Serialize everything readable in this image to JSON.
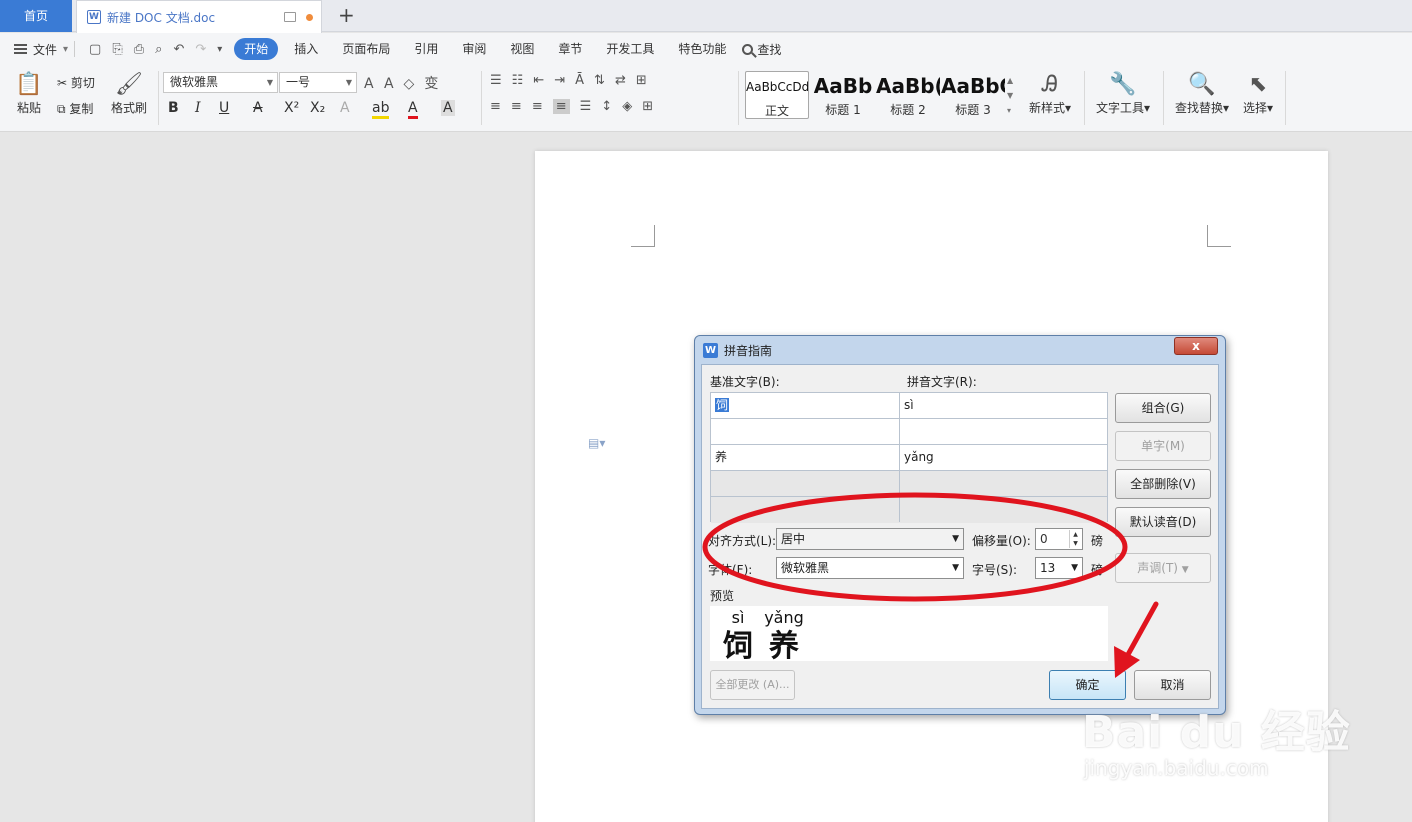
{
  "tabbar": {
    "home_label": "首页",
    "doc_tab_label": "新建 DOC 文档.doc",
    "add_label": "+"
  },
  "menubar": {
    "file_label": "文件",
    "tabs": [
      "开始",
      "插入",
      "页面布局",
      "引用",
      "审阅",
      "视图",
      "章节",
      "开发工具",
      "特色功能"
    ],
    "search_label": "查找",
    "active_tab": "开始"
  },
  "ribbon": {
    "paste_label": "粘贴",
    "cut_label": "剪切",
    "copy_label": "复制",
    "format_painter_label": "格式刷",
    "font_name": "微软雅黑",
    "font_size": "一号",
    "styles": [
      {
        "sample": "AaBbCcDd",
        "name": "正文"
      },
      {
        "sample": "AaBb",
        "name": "标题 1"
      },
      {
        "sample": "AaBb(",
        "name": "标题 2"
      },
      {
        "sample": "AaBbC(",
        "name": "标题 3"
      }
    ],
    "new_style_label": "新样式",
    "text_tools_label": "文字工具",
    "find_replace_label": "查找替换",
    "select_label": "选择"
  },
  "dialog": {
    "title": "拼音指南",
    "close_label": "x",
    "base_text_label": "基准文字(B):",
    "pinyin_text_label": "拼音文字(R):",
    "rows": [
      {
        "base": "饲",
        "pinyin": "sì",
        "disabled": false
      },
      {
        "base": "",
        "pinyin": "",
        "disabled": false
      },
      {
        "base": "养",
        "pinyin": "yǎng",
        "disabled": false
      },
      {
        "base": "",
        "pinyin": "",
        "disabled": true
      },
      {
        "base": "",
        "pinyin": "",
        "disabled": true
      }
    ],
    "buttons": {
      "combine": "组合(G)",
      "single": "单字(M)",
      "delete_all": "全部删除(V)",
      "default_reading": "默认读音(D)",
      "tone": "声调(T)",
      "change_all": "全部更改 (A)...",
      "ok": "确定",
      "cancel": "取消"
    },
    "alignment_label": "对齐方式(L):",
    "alignment_value": "居中",
    "offset_label": "偏移量(O):",
    "offset_value": "0",
    "offset_unit": "磅",
    "font_label": "字体(F):",
    "font_value": "微软雅黑",
    "size_label": "字号(S):",
    "size_value": "13",
    "size_unit": "磅",
    "preview_label": "预览",
    "preview": [
      {
        "pinyin": "sì",
        "char": "饲"
      },
      {
        "pinyin": "yǎng",
        "char": "养"
      }
    ]
  },
  "watermark": {
    "brand": "Bai du 经验",
    "site": "jingyan.baidu.com"
  },
  "colors": {
    "accent": "#3a7bd5",
    "annotation_red": "#e0141e"
  }
}
